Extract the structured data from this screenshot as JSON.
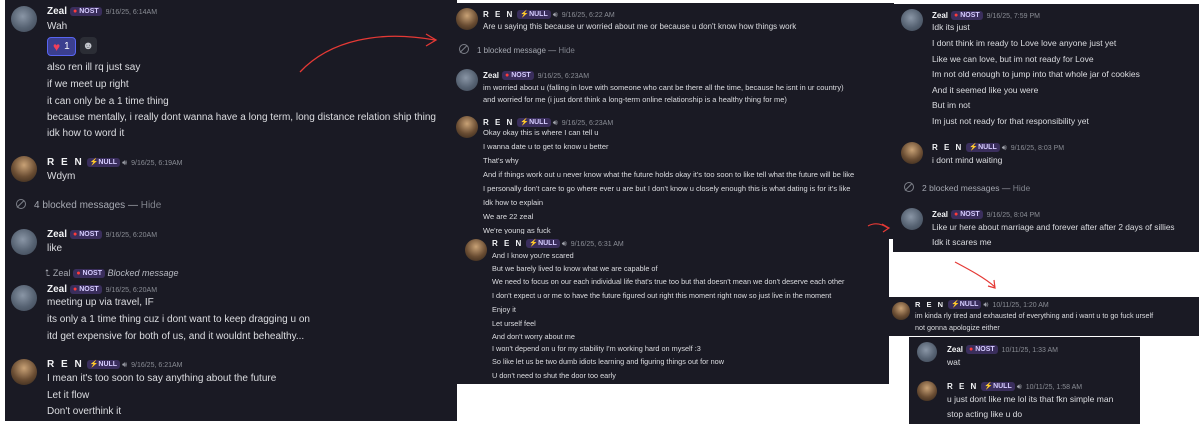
{
  "accent": "#ff3b3b",
  "panel_bg": "#1a1a24",
  "left": {
    "zeal1": {
      "name": "Zeal",
      "tag": "NOST",
      "time": "9/16/25, 6:14AM",
      "lines": [
        "Wah"
      ],
      "reaction": {
        "emoji": "heart",
        "count": "1"
      },
      "more": [
        "also ren ill rq just say",
        "if we meet up right",
        "it can only be a 1 time thing",
        "because mentally, i really dont wanna have a long term, long distance relation ship thing",
        "idk how to word it"
      ]
    },
    "ren1": {
      "name": "R E N",
      "tag": "NULL",
      "time": "9/16/25, 6:19AM",
      "lines": [
        "Wdym"
      ]
    },
    "blocked": {
      "text": "4 blocked messages —",
      "hide": "Hide"
    },
    "zeal2": {
      "name": "Zeal",
      "tag": "NOST",
      "time": "9/16/25, 6:20AM",
      "lines": [
        "like"
      ]
    },
    "reply": {
      "name": "Zeal",
      "tag": "NOST",
      "text": "Blocked message"
    },
    "zeal3": {
      "name": "Zeal",
      "tag": "NOST",
      "time": "9/16/25, 6:20AM",
      "lines": [
        "meeting up via travel, IF",
        "its only a 1 time thing cuz i dont want to keep dragging u on",
        "itd get expensive for both of us, and it wouldnt behealthy..."
      ]
    },
    "ren2": {
      "name": "R E N",
      "tag": "NULL",
      "time": "9/16/25, 6:21AM",
      "lines": [
        "I mean it's too soon to say anything about the future",
        "Let it flow",
        "Don't overthink it"
      ]
    }
  },
  "mid": {
    "ren1": {
      "name": "R E N",
      "tag": "NULL",
      "time": "9/16/25, 6:22 AM",
      "lines": [
        "Are u saying this because ur worried about me or because u don't know how things work"
      ]
    },
    "blocked": {
      "text": "1 blocked message —",
      "hide": "Hide"
    },
    "zeal1": {
      "name": "Zeal",
      "tag": "NOST",
      "time": "9/16/25, 6:23AM",
      "lines": [
        "im worried about u (falling in love with someone who cant be there all the time, because he isnt in ur country)",
        "and worried for me (i just dont think a long-term online relationship is a healthy thing for me)"
      ]
    },
    "ren2": {
      "name": "R E N",
      "tag": "NULL",
      "time": "9/16/25, 6:23AM",
      "lines": [
        "Okay okay this is where I can tell u",
        "I wanna date u to get to know u better",
        "That's why",
        "And if things work out u never know what the future holds okay it's too soon to like tell what the future will be like",
        "I personally don't care to go where ever u are but I don't know u closely enough this is what dating is for it's like",
        "Idk how to explain",
        "We are 22 zeal",
        "We're young as fuck"
      ]
    }
  },
  "mid2": {
    "ren": {
      "name": "R E N",
      "tag": "NULL",
      "time": "9/16/25, 6:31 AM",
      "lines": [
        "And I know you're scared",
        "But we barely lived to know what we are capable of",
        "We need to focus on our each individual life that's true too but that doesn't mean we don't deserve each other",
        "I don't expect u or me to have the future figured out right this moment right now so just live in the moment",
        "Enjoy it",
        "Let urself feel",
        "And don't worry about me",
        "I won't depend on u for my stability I'm working hard on myself :3",
        "So like let us be two dumb idiots learning and figuring things out for now",
        "U don't need to shut the door too early"
      ]
    }
  },
  "right": {
    "zeal1": {
      "name": "Zeal",
      "tag": "NOST",
      "time": "9/16/25, 7:59 PM",
      "lines": [
        "Idk its just",
        "I dont think im ready to Love love anyone just yet",
        "Like we can love, but im not ready for Love",
        "Im not old enough to jump into that whole jar of cookies",
        "And it seemed like you were",
        "But im not",
        "Im just not ready for that responsibility yet"
      ]
    },
    "ren1": {
      "name": "R E N",
      "tag": "NULL",
      "time": "9/16/25, 8:03 PM",
      "lines": [
        "i dont mind waiting"
      ]
    },
    "blocked": {
      "text": "2 blocked messages —",
      "hide": "Hide"
    },
    "zeal2": {
      "name": "Zeal",
      "tag": "NOST",
      "time": "9/16/25, 8:04 PM",
      "lines": [
        "Like ur here about marriage and forever after after 2 days of sillies",
        "Idk it scares me"
      ]
    }
  },
  "right2": {
    "ren": {
      "name": "R E N",
      "tag": "NULL",
      "time": "10/11/25, 1:20 AM",
      "lines": [
        "im kinda rly tired and exhausted of everything and i want u to go fuck urself",
        "not gonna apologize either"
      ]
    }
  },
  "right3": {
    "zeal": {
      "name": "Zeal",
      "tag": "NOST",
      "time": "10/11/25, 1:33 AM",
      "lines": [
        "wat"
      ]
    },
    "ren": {
      "name": "R E N",
      "tag": "NULL",
      "time": "10/11/25, 1:58 AM",
      "lines": [
        "u just dont like me lol its that fkn simple man",
        "stop acting like u do"
      ]
    }
  }
}
